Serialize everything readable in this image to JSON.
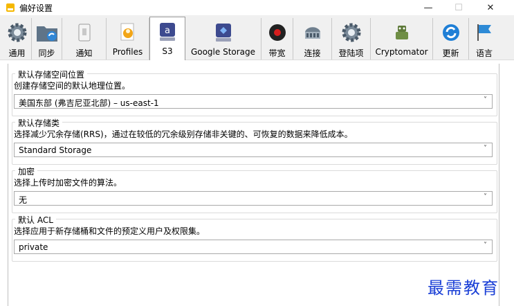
{
  "window": {
    "title": "偏好设置",
    "minimize": "—",
    "maximize": "☐",
    "close": "✕"
  },
  "tabs": [
    {
      "label": "通用",
      "icon": "gear-icon"
    },
    {
      "label": "同步",
      "icon": "folder-sync-icon"
    },
    {
      "label": "通知",
      "icon": "switch-icon"
    },
    {
      "label": "Profiles",
      "icon": "profile-doc-icon"
    },
    {
      "label": "S3",
      "icon": "s3-drive-icon",
      "active": true
    },
    {
      "label": "Google Storage",
      "icon": "google-storage-icon"
    },
    {
      "label": "带宽",
      "icon": "gauge-icon"
    },
    {
      "label": "连接",
      "icon": "network-card-icon"
    },
    {
      "label": "登陆项",
      "icon": "gear-icon"
    },
    {
      "label": "Cryptomator",
      "icon": "robot-icon"
    },
    {
      "label": "更新",
      "icon": "refresh-icon"
    },
    {
      "label": "语言",
      "icon": "flag-icon"
    }
  ],
  "groups": [
    {
      "title": "默认存储空间位置",
      "description": "创建存储空间的默认地理位置。",
      "value": "美国东部 (弗吉尼亚北部) – us-east-1"
    },
    {
      "title": "默认存储类",
      "description": "选择减少冗余存储(RRS)，通过在较低的冗余级别存储非关键的、可恢复的数据来降低成本。",
      "value": "Standard Storage"
    },
    {
      "title": "加密",
      "description": "选择上传时加密文件的算法。",
      "value": "无"
    },
    {
      "title": "默认 ACL",
      "description": "选择应用于新存储桶和文件的预定义用户及权限集。",
      "value": "private"
    }
  ],
  "watermark": "最需教育",
  "colors": {
    "accent": "#1a3fd6",
    "toolbar": "#f0f0f0"
  }
}
